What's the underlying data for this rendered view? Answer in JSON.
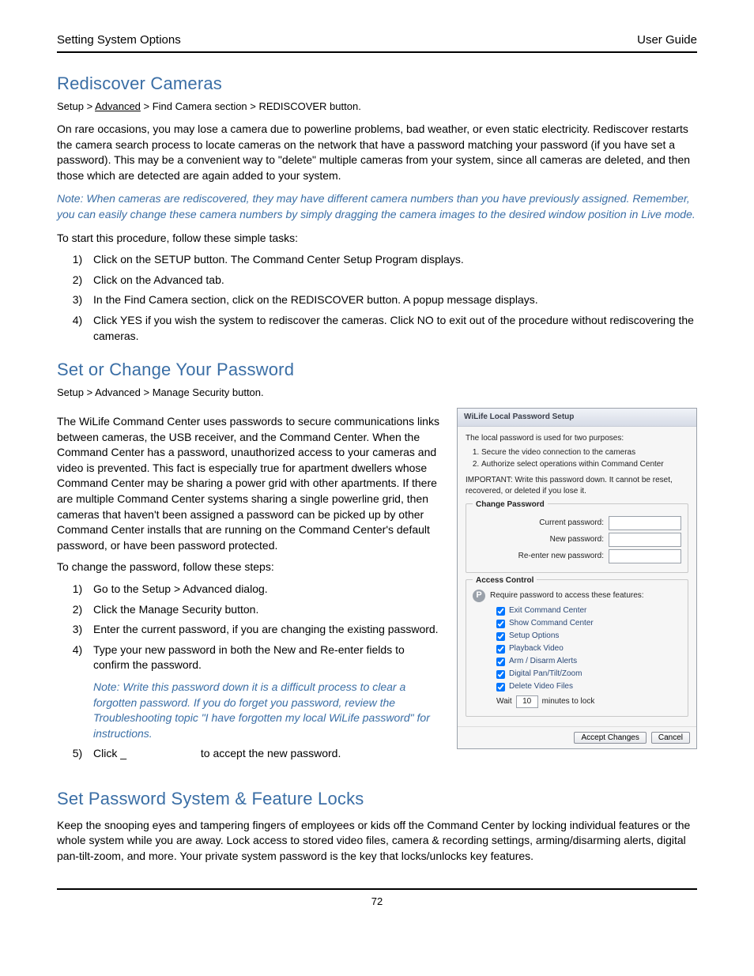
{
  "header": {
    "left": "Setting System Options",
    "right": "User Guide"
  },
  "sections": {
    "rediscover": {
      "title": "Rediscover Cameras",
      "crumb_pre": "Setup > ",
      "crumb_u": "Advanced",
      "crumb_post": " > Find Camera section > REDISCOVER button.",
      "p1": "On rare occasions, you may lose a camera due to powerline problems, bad weather, or even static electricity. Rediscover restarts the camera search process to locate cameras on the network that have a password matching your password (if you have set a password). This may be a convenient way to \"delete\" multiple cameras from your system, since all cameras are deleted, and then those which are detected are again added to your system.",
      "note": "Note: When cameras are rediscovered, they may have different camera numbers than you have previously assigned. Remember, you can easily change these camera numbers by simply dragging the camera images to the desired window position in Live mode.",
      "lead": "To start this procedure, follow these simple tasks:",
      "steps": [
        "Click on the SETUP button.  The Command Center Setup Program displays.",
        "Click on the Advanced tab.",
        "In the Find Camera section, click on the REDISCOVER button.  A popup message displays.",
        "Click YES if you wish the system to rediscover the cameras. Click NO to exit out of the procedure without rediscovering the cameras."
      ]
    },
    "password": {
      "title": "Set or Change Your Password",
      "crumb": "Setup > Advanced > Manage Security button.",
      "p1": "The WiLife Command Center uses passwords to secure communications links between cameras, the USB receiver, and the Command Center. When the Command Center has a password, unauthorized access to your cameras and video is prevented. This fact is especially true for apartment dwellers whose Command Center may be sharing a power grid with other apartments. If there are multiple Command Center systems sharing a single powerline grid, then cameras that haven't been assigned a password can be picked up by other Command Center installs that are running on the Command Center's default password, or have been password protected.",
      "lead": "To change the password, follow these steps:",
      "steps": [
        "Go to the Setup > Advanced dialog.",
        "Click the Manage Security button.",
        "Enter the current password, if you are changing the existing password.",
        "Type your new password in both the New and Re-enter fields to confirm the password."
      ],
      "step_note": "Note: Write this password down it is a difficult process to clear a forgotten password. If you do forget you password, review the Troubleshooting topic \"I have forgotten my local WiLife password\" for instructions.",
      "step5_a": "Click ",
      "step5_b": "_",
      "step5_c": " to accept the new password."
    },
    "locks": {
      "title": "Set Password System & Feature Locks",
      "p1": "Keep the snooping eyes and tampering fingers of employees or kids off the Command Center by locking individual features or the whole system while you are away.  Lock access to stored video files, camera & recording settings, arming/disarming alerts, digital pan-tilt-zoom, and more.  Your private system password is the key that locks/unlocks key features."
    }
  },
  "dialog": {
    "title": "WiLife Local Password Setup",
    "intro": "The local password is used for two purposes:",
    "purposes": [
      "Secure the video connection to the cameras",
      "Authorize select operations within Command Center"
    ],
    "important": "IMPORTANT:  Write this password down.  It cannot be reset, recovered, or deleted if you lose it.",
    "change_title": "Change Password",
    "labels": {
      "current": "Current password:",
      "new": "New password:",
      "reenter": "Re-enter new password:"
    },
    "access_title": "Access Control",
    "access_lead": "Require password to access these features:",
    "checks": [
      "Exit Command Center",
      "Show Command Center",
      "Setup Options",
      "Playback Video",
      "Arm / Disarm Alerts",
      "Digital Pan/Tilt/Zoom",
      "Delete Video Files"
    ],
    "wait_pre": "Wait",
    "wait_val": "10",
    "wait_post": "minutes to lock",
    "accept": "Accept Changes",
    "cancel": "Cancel"
  },
  "footer": {
    "page": "72"
  }
}
